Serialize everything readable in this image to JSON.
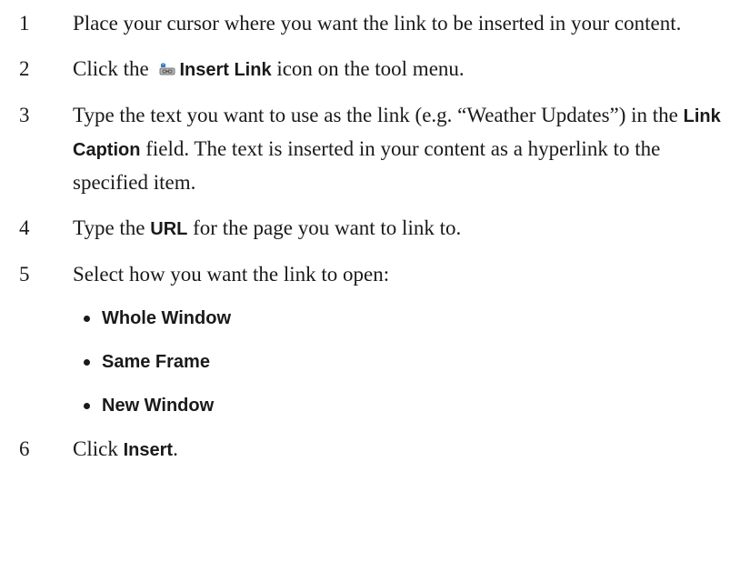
{
  "steps": [
    {
      "number": "1",
      "text": "Place your cursor where you want the link to be inserted in your content."
    },
    {
      "number": "2",
      "before": "Click the ",
      "ui_label": "Insert Link",
      "after": " icon on the tool menu.",
      "icon": "insert-link-icon"
    },
    {
      "number": "3",
      "before": "Type the text you want to use as the link (e.g. “Weather Updates”) in the ",
      "ui_label": "Link Caption",
      "after": " field. The text is inserted in your content as a hyperlink to the specified item."
    },
    {
      "number": "4",
      "before": "Type the ",
      "ui_label": "URL",
      "after": " for the page you want to link to."
    },
    {
      "number": "5",
      "text": "Select how you want the link to open:",
      "options": [
        "Whole Window",
        "Same Frame",
        "New Window"
      ]
    },
    {
      "number": "6",
      "before": "Click ",
      "ui_label": "Insert",
      "after": "."
    }
  ],
  "colors": {
    "text": "#1a1a1a",
    "icon_blue": "#3a7bd5",
    "icon_gray": "#8c8c8c"
  }
}
